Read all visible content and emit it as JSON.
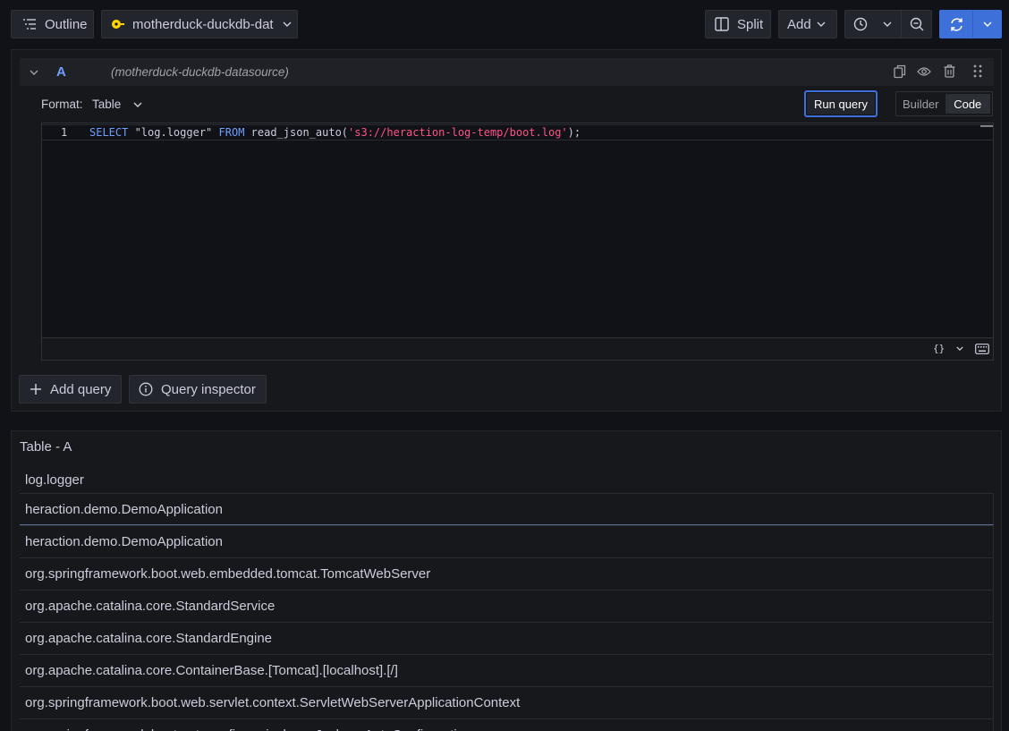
{
  "toolbar": {
    "outline_label": "Outline",
    "datasource_name": "motherduck-duckdb-dat",
    "split_label": "Split",
    "add_label": "Add"
  },
  "query": {
    "letter": "A",
    "datasource_label": "(motherduck-duckdb-datasource)",
    "format_label": "Format:",
    "format_value": "Table",
    "run_label": "Run query",
    "modes": [
      "Builder",
      "Code"
    ],
    "active_mode": "Code",
    "line_number": "1",
    "code": {
      "kw1": "SELECT",
      "col": " \"log.logger\" ",
      "kw2": "FROM",
      "fn": " read_json_auto(",
      "str": "'s3://heraction-log-temp/boot.log'",
      "end": ");"
    },
    "footer_braces": "{}"
  },
  "actions": {
    "add_query_label": "Add query",
    "inspector_label": "Query inspector"
  },
  "table": {
    "title": "Table - A",
    "column": "log.logger",
    "rows": [
      "heraction.demo.DemoApplication",
      "heraction.demo.DemoApplication",
      "org.springframework.boot.web.embedded.tomcat.TomcatWebServer",
      "org.apache.catalina.core.StandardService",
      "org.apache.catalina.core.StandardEngine",
      "org.apache.catalina.core.ContainerBase.[Tomcat].[localhost].[/]",
      "org.springframework.boot.web.servlet.context.ServletWebServerApplicationContext",
      "org.springframework.boot.autoconfigure.jackson.JacksonAutoConfiguration"
    ]
  },
  "colors": {
    "accent": "#3d71d9",
    "keyword": "#6e9fff",
    "string": "#ff5286",
    "datasource_dot": "#ffd500"
  },
  "icons": [
    "outline-icon",
    "duck-icon",
    "chevron-down-icon",
    "split-icon",
    "clock-icon",
    "zoom-out-icon",
    "refresh-icon",
    "copy-icon",
    "eye-icon",
    "trash-icon",
    "drag-handle-icon",
    "plus-icon",
    "info-icon",
    "keyboard-icon"
  ]
}
